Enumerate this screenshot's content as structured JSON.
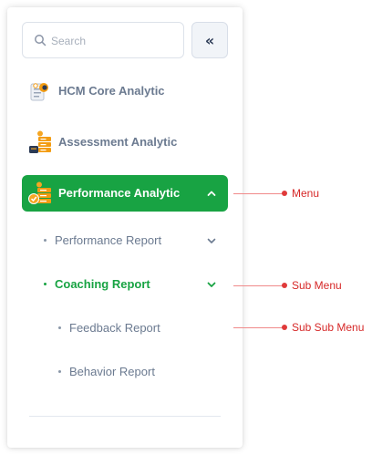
{
  "search": {
    "placeholder": "Search"
  },
  "collapse_button": {
    "label": "«"
  },
  "menu": [
    {
      "label": "HCM Core Analytic",
      "icon": "hcm-core-analytic-icon"
    },
    {
      "label": "Assessment Analytic",
      "icon": "assessment-analytic-icon"
    },
    {
      "label": "Performance Analytic",
      "icon": "performance-analytic-icon",
      "active": true,
      "expanded": true
    }
  ],
  "submenu": [
    {
      "label": "Performance Report",
      "expanded": false
    },
    {
      "label": "Coaching Report",
      "active": true,
      "expanded": true
    }
  ],
  "subsubmenu": [
    {
      "label": "Feedback Report"
    },
    {
      "label": "Behavior Report"
    }
  ],
  "annotations": {
    "menu": "Menu",
    "sub_menu": "Sub Menu",
    "sub_sub_menu": "Sub Sub Menu"
  },
  "colors": {
    "accent": "#18a343",
    "annotation": "#d62828",
    "text_muted": "#6b7a90"
  }
}
